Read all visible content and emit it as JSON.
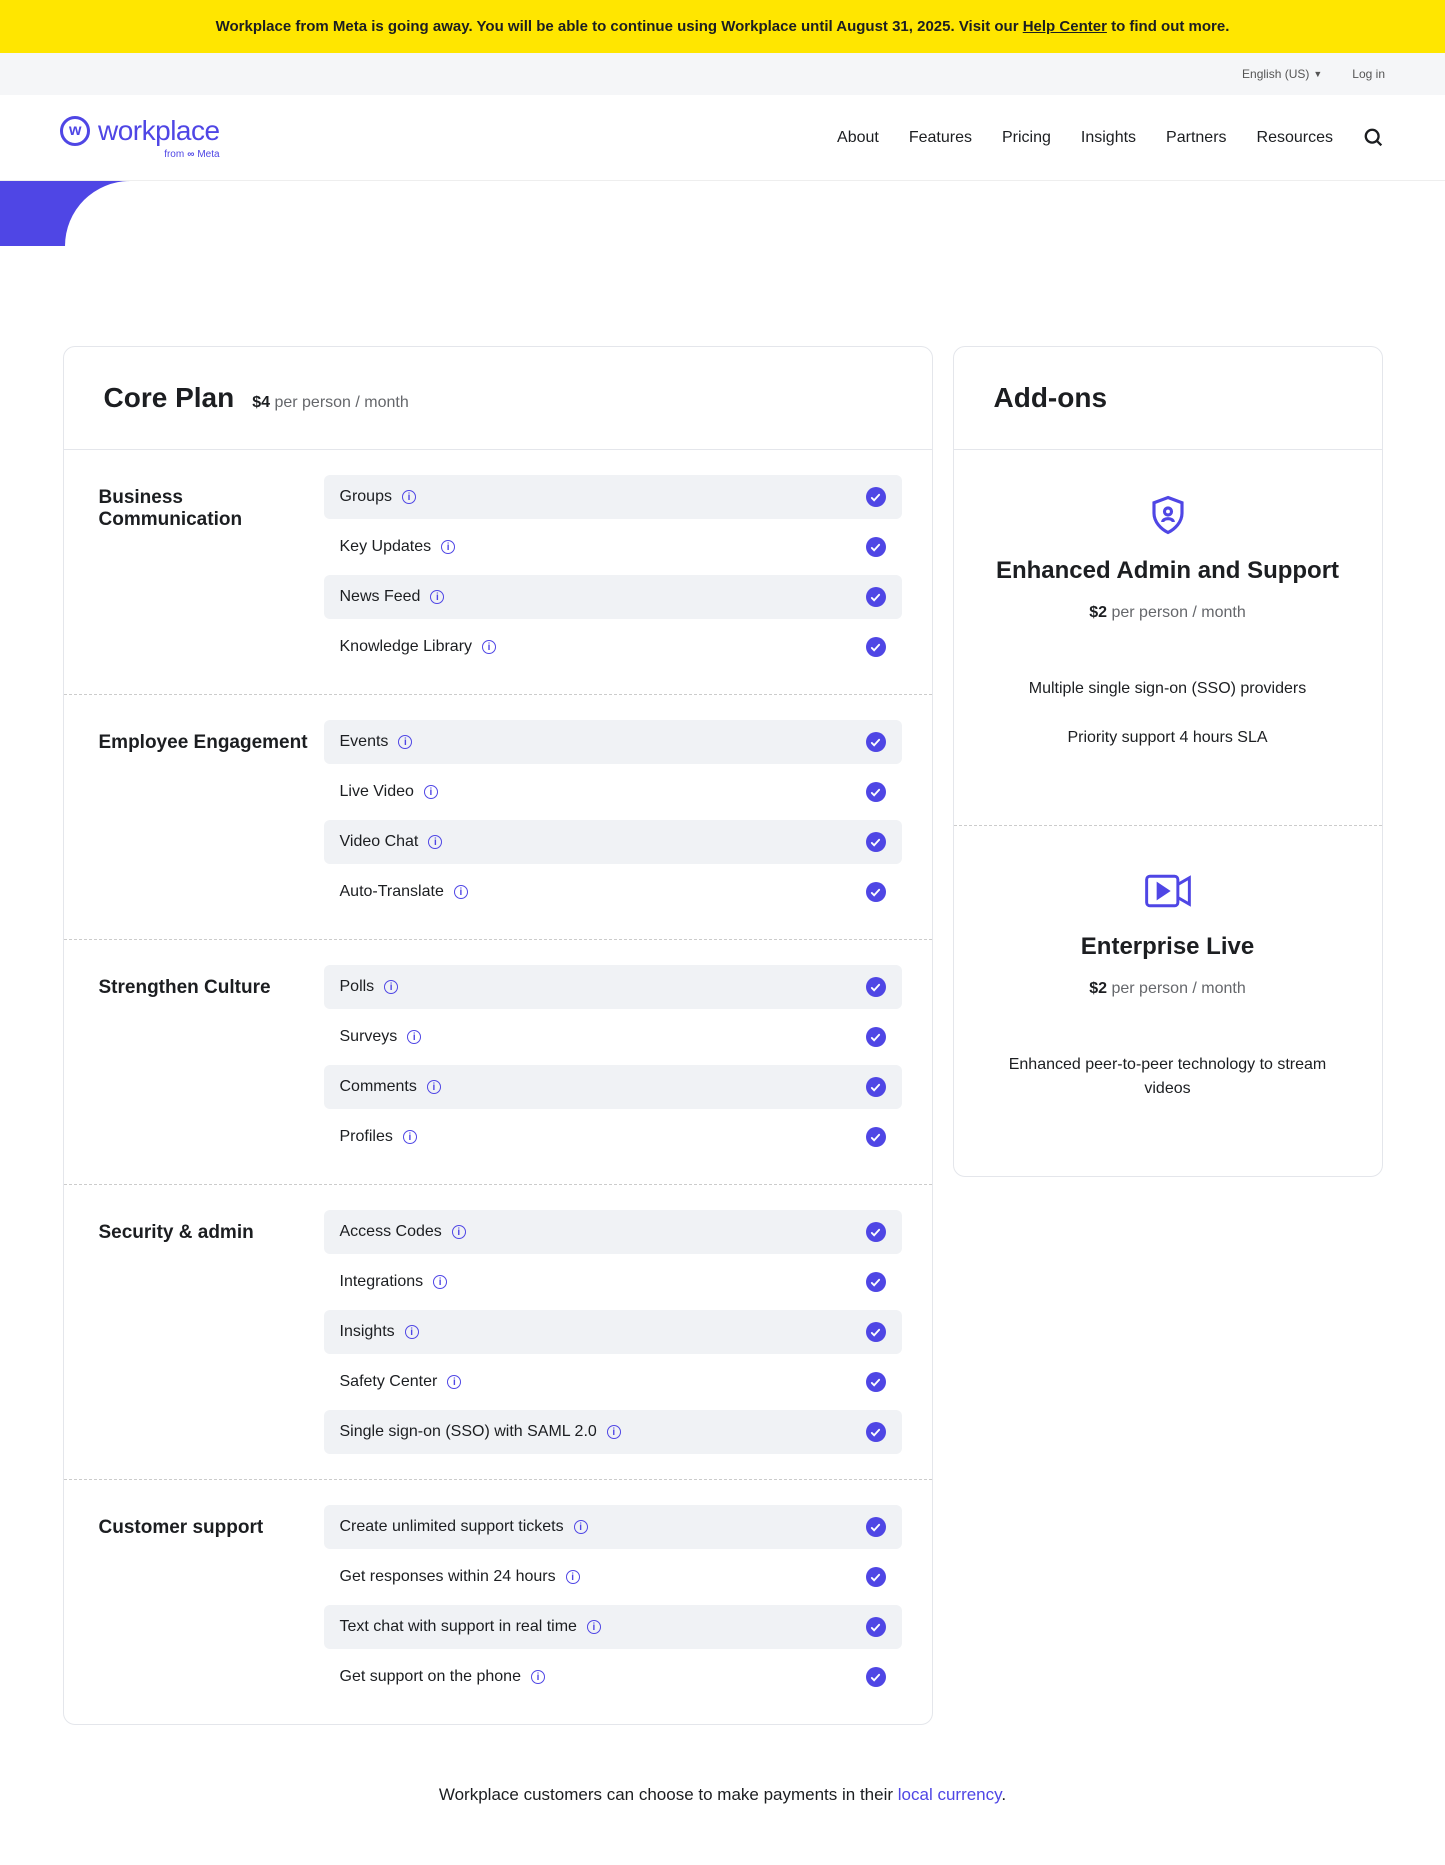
{
  "banner": {
    "text_prefix": "Workplace from Meta is going away. You will be able to continue using Workplace until August 31, 2025. Visit our ",
    "link_text": "Help Center",
    "text_suffix": " to find out more."
  },
  "topbar": {
    "language": "English (US)",
    "login": "Log in"
  },
  "logo": {
    "text": "workplace",
    "sub_prefix": "from",
    "sub_brand": "Meta"
  },
  "nav": [
    "About",
    "Features",
    "Pricing",
    "Insights",
    "Partners",
    "Resources"
  ],
  "core": {
    "title": "Core Plan",
    "price": "$4",
    "price_per": "per person / month"
  },
  "sections": [
    {
      "title": "Business Communication",
      "features": [
        "Groups",
        "Key Updates",
        "News Feed",
        "Knowledge Library"
      ]
    },
    {
      "title": "Employee Engagement",
      "features": [
        "Events",
        "Live Video",
        "Video Chat",
        "Auto-Translate"
      ]
    },
    {
      "title": "Strengthen Culture",
      "features": [
        "Polls",
        "Surveys",
        "Comments",
        "Profiles"
      ]
    },
    {
      "title": "Security & admin",
      "features": [
        "Access Codes",
        "Integrations",
        "Insights",
        "Safety Center",
        "Single sign-on (SSO) with SAML 2.0"
      ]
    },
    {
      "title": "Customer support",
      "features": [
        "Create unlimited support tickets",
        "Get responses within 24 hours",
        "Text chat with support in real time",
        "Get support on the phone"
      ]
    }
  ],
  "addons": {
    "title": "Add-ons",
    "items": [
      {
        "name": "Enhanced Admin and Support",
        "price": "$2",
        "price_per": "per person / month",
        "descriptions": [
          "Multiple single sign-on (SSO) providers",
          "Priority support 4 hours SLA"
        ]
      },
      {
        "name": "Enterprise Live",
        "price": "$2",
        "price_per": "per person / month",
        "descriptions": [
          "Enhanced peer-to-peer technology to stream videos"
        ]
      }
    ]
  },
  "footer": {
    "text": "Workplace customers can choose to make payments in their ",
    "link": "local currency",
    "suffix": "."
  }
}
